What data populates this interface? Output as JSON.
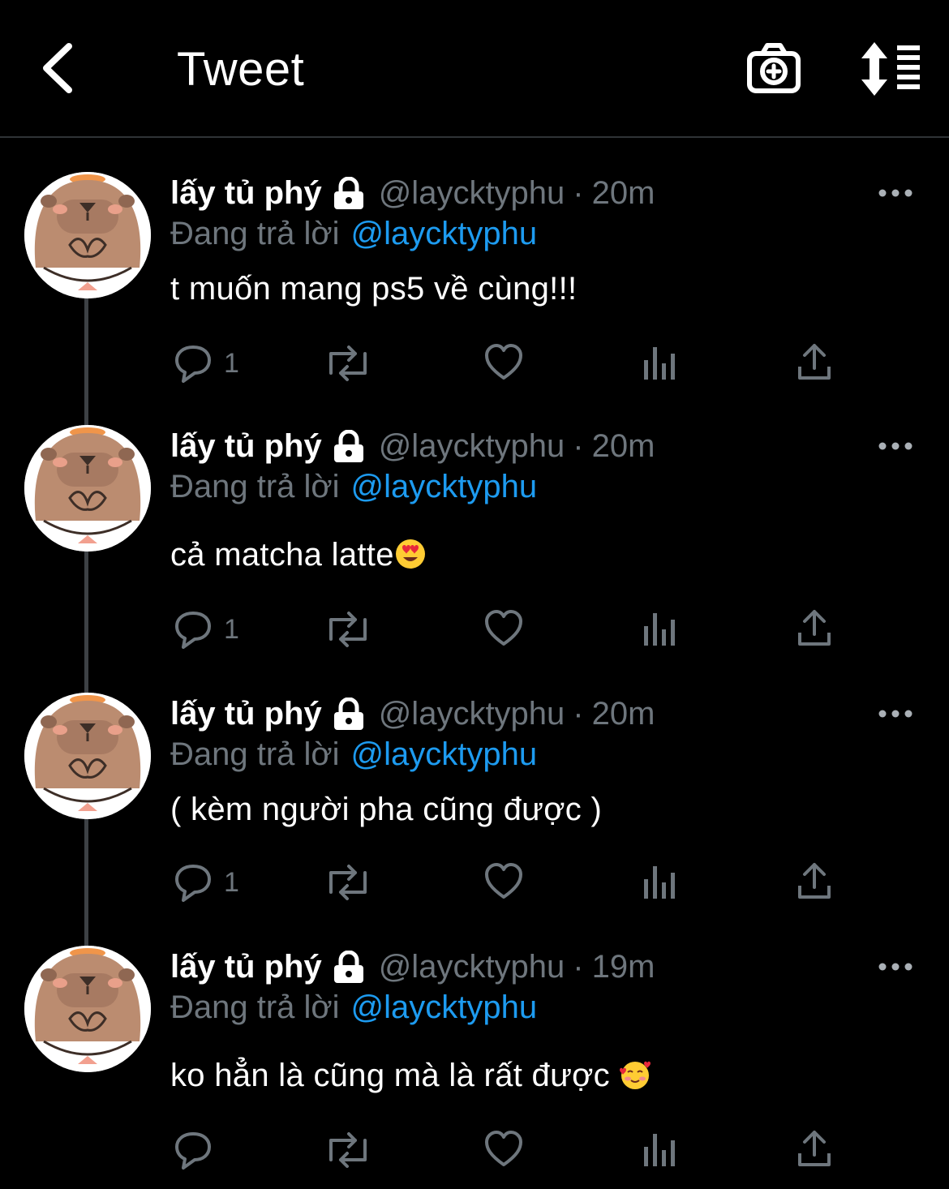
{
  "header": {
    "title": "Tweet",
    "back_icon": "chevron-left-icon",
    "camera_icon": "camera-plus-icon",
    "sort_icon": "sort-list-icon"
  },
  "colors": {
    "background": "#000000",
    "text": "#ffffff",
    "muted": "#6e767d",
    "link": "#1d9bf0",
    "divider": "#2f3336"
  },
  "tweets": [
    {
      "display_name": "lấy tủ phý",
      "handle": "@laycktyphu",
      "separator": "·",
      "time": "20m",
      "reply_label": "Đang trả lời",
      "reply_to": "@laycktyphu",
      "text": "t muốn mang ps5 về cùng!!!",
      "emoji": "",
      "reply_count": "1"
    },
    {
      "display_name": "lấy tủ phý",
      "handle": "@laycktyphu",
      "separator": "·",
      "time": "20m",
      "reply_label": "Đang trả lời",
      "reply_to": "@laycktyphu",
      "text": "cả matcha latte",
      "emoji": "heart-eyes-emoji",
      "reply_count": "1"
    },
    {
      "display_name": "lấy tủ phý",
      "handle": "@laycktyphu",
      "separator": "·",
      "time": "20m",
      "reply_label": "Đang trả lời",
      "reply_to": "@laycktyphu",
      "text": "( kèm người pha cũng được )",
      "emoji": "",
      "reply_count": "1"
    },
    {
      "display_name": "lấy tủ phý",
      "handle": "@laycktyphu",
      "separator": "·",
      "time": "19m",
      "reply_label": "Đang trả lời",
      "reply_to": "@laycktyphu",
      "text": "ko hẳn là cũng mà là rất được ",
      "emoji": "smiling-hearts-emoji",
      "reply_count": ""
    }
  ]
}
